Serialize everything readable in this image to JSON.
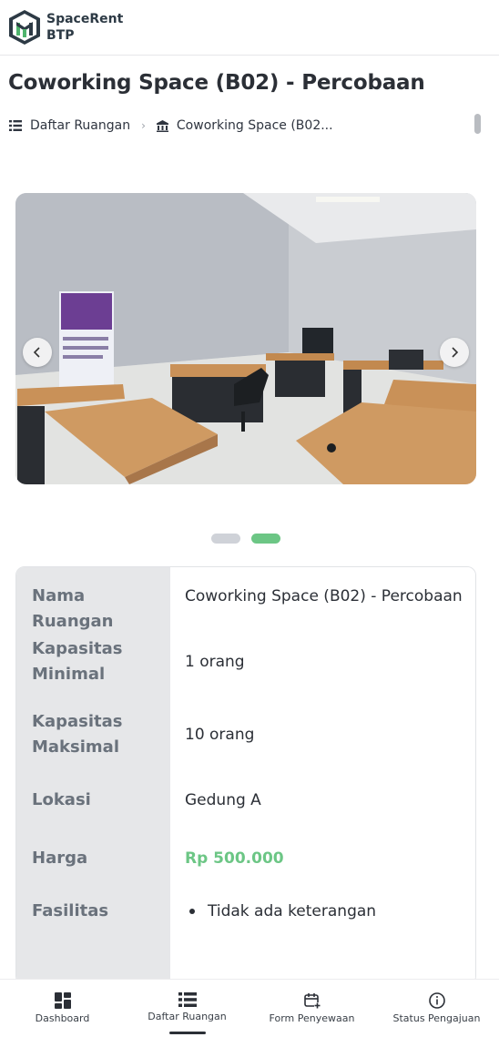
{
  "app": {
    "brand_line1": "SpaceRent",
    "brand_line2": "BTP",
    "logo_icon": "spacerent-logo-icon"
  },
  "page": {
    "title": "Coworking Space (B02) - Percobaan"
  },
  "breadcrumb": {
    "items": [
      {
        "label": "Daftar Ruangan",
        "icon": "list-icon"
      },
      {
        "label": "Coworking Space (B02...",
        "icon": "building-icon"
      }
    ]
  },
  "carousel": {
    "prev_icon": "chevron-left-icon",
    "next_icon": "chevron-right-icon",
    "slide_count": 2,
    "active_slide": 2
  },
  "details": {
    "rows": [
      {
        "label": "Nama Ruangan",
        "value": "Coworking Space (B02) - Percobaan"
      },
      {
        "label": "Kapasitas Minimal",
        "value": "1 orang"
      },
      {
        "label": "Kapasitas Maksimal",
        "value": "10 orang"
      },
      {
        "label": "Lokasi",
        "value": "Gedung A"
      },
      {
        "label": "Harga",
        "value": "Rp 500.000"
      },
      {
        "label": "Fasilitas",
        "value": "Tidak ada keterangan"
      }
    ]
  },
  "bottom_nav": {
    "items": [
      {
        "label": "Dashboard",
        "icon": "dashboard-icon"
      },
      {
        "label": "Daftar Ruangan",
        "icon": "list-icon",
        "active": true
      },
      {
        "label": "Form Penyewaan",
        "icon": "calendar-add-icon"
      },
      {
        "label": "Status Pengajuan",
        "icon": "info-icon"
      }
    ]
  },
  "colors": {
    "accent": "#6cc685",
    "brand_dark": "#2d3a45"
  }
}
